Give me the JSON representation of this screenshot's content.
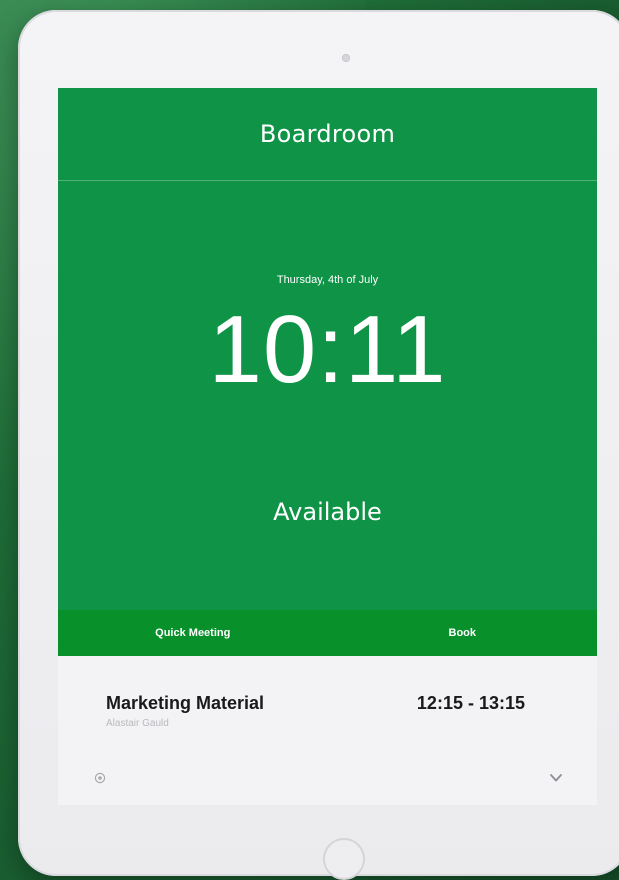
{
  "room": {
    "name": "Boardroom"
  },
  "clock": {
    "date": "Thursday, 4th of July",
    "time": "10:11",
    "status": "Available"
  },
  "actions": {
    "quick_meeting_label": "Quick Meeting",
    "book_label": "Book"
  },
  "next_meeting": {
    "title": "Marketing Material",
    "organizer": "Alastair Gauld",
    "time_range": "12:15 - 13:15"
  },
  "icons": {
    "settings": "gear-icon",
    "expand": "chevron-down-icon"
  },
  "colors": {
    "screen_background": "#0f9447",
    "action_bar": "#08912a",
    "panel_background": "#f3f3f5",
    "page_background": "#1f6e38"
  }
}
